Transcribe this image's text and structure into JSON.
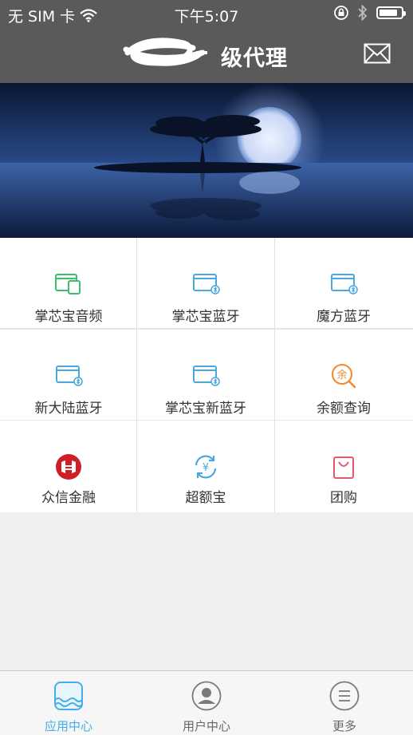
{
  "status_bar": {
    "carrier": "无 SIM 卡",
    "time": "下午5:07",
    "battery_level": 0.85
  },
  "nav": {
    "title": "级代理",
    "title_prefix_redacted": true
  },
  "grid": {
    "items": [
      {
        "label": "掌芯宝音频",
        "icon": "card-audio-icon",
        "color": "#3cbf6b"
      },
      {
        "label": "掌芯宝蓝牙",
        "icon": "card-bluetooth-icon",
        "color": "#4aa7e0"
      },
      {
        "label": "魔方蓝牙",
        "icon": "card-bluetooth-icon",
        "color": "#4aa7e0"
      },
      {
        "label": "新大陆蓝牙",
        "icon": "card-bluetooth-icon",
        "color": "#4aa7e0"
      },
      {
        "label": "掌芯宝新蓝牙",
        "icon": "card-bluetooth-icon",
        "color": "#4aa7e0"
      },
      {
        "label": "余额查询",
        "icon": "balance-query-icon",
        "color": "#f08a2a"
      },
      {
        "label": "众信金融",
        "icon": "finance-logo-icon",
        "color": "#cf1f26"
      },
      {
        "label": "超额宝",
        "icon": "yen-exchange-icon",
        "color": "#4aa7e0"
      },
      {
        "label": "团购",
        "icon": "shopping-bag-icon",
        "color": "#e45a6a"
      }
    ]
  },
  "tabs": [
    {
      "label": "应用中心",
      "icon": "app-center-icon",
      "active": true
    },
    {
      "label": "用户中心",
      "icon": "user-icon",
      "active": false
    },
    {
      "label": "更多",
      "icon": "more-menu-icon",
      "active": false
    }
  ],
  "colors": {
    "bar": "#5a5a5a",
    "accent": "#45aee6",
    "background": "#efefef"
  }
}
